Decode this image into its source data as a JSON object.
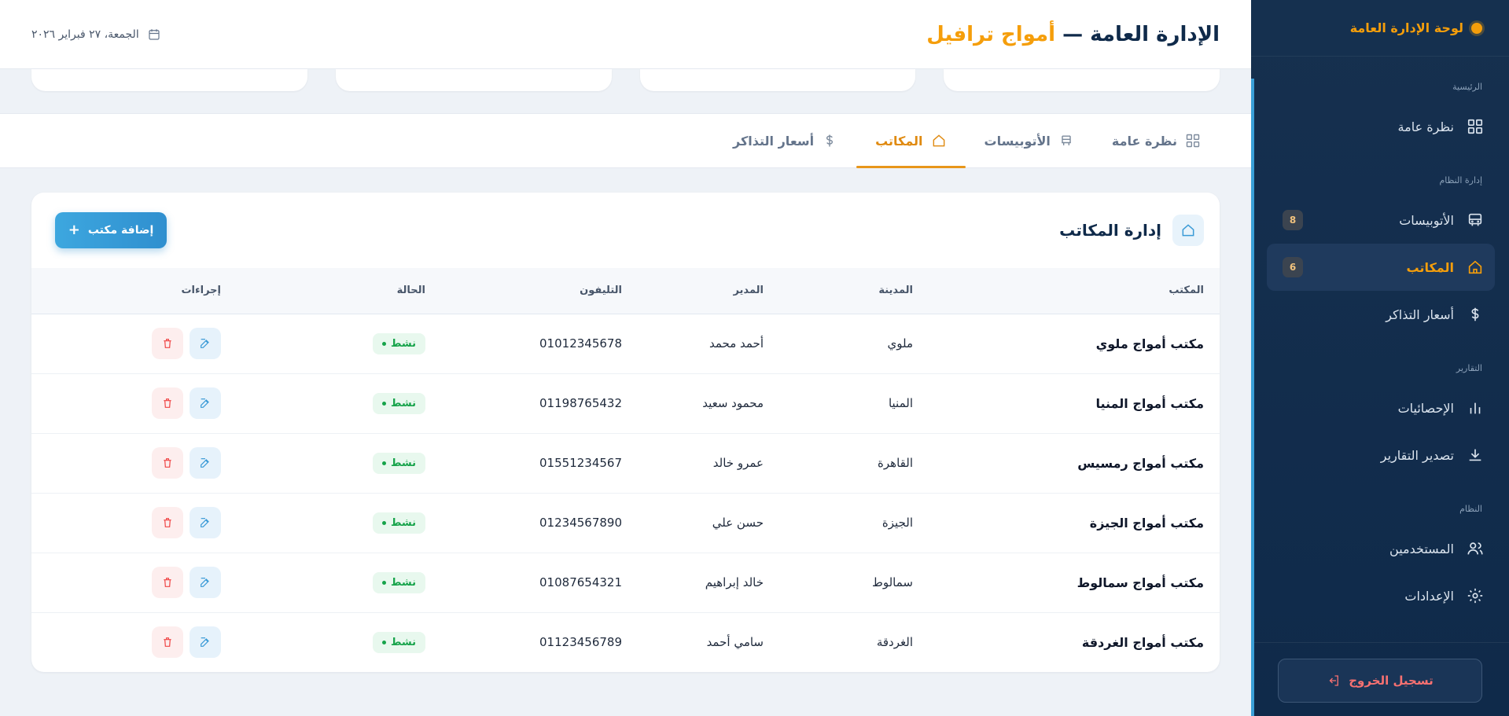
{
  "sidebar": {
    "brand": "لوحة الإدارة العامة",
    "sections": {
      "home": "الرئيسية",
      "system_mgmt": "إدارة النظام",
      "reports": "التقارير",
      "system": "النظام"
    },
    "items": {
      "overview": "نظرة عامة",
      "buses": "الأتوبيسات",
      "buses_count": "8",
      "offices": "المكاتب",
      "offices_count": "6",
      "ticket_prices": "أسعار التذاكر",
      "statistics": "الإحصائيات",
      "export_reports": "تصدير التقارير",
      "users": "المستخدمين",
      "settings": "الإعدادات"
    },
    "logout": "تسجيل الخروج"
  },
  "header": {
    "title_main": "الإدارة العامة —",
    "title_accent": "أمواج ترافيل",
    "date": "الجمعة، ٢٧ فبراير ٢٠٢٦"
  },
  "tabs": [
    {
      "label": "نظرة عامة",
      "icon": "grid-icon"
    },
    {
      "label": "الأتوبيسات",
      "icon": "bus-icon"
    },
    {
      "label": "المكاتب",
      "icon": "home-icon",
      "active": true
    },
    {
      "label": "أسعار التذاكر",
      "icon": "dollar-icon"
    }
  ],
  "panel": {
    "title": "إدارة المكاتب",
    "add_button": "إضافة مكتب"
  },
  "table": {
    "headers": {
      "office": "المكتب",
      "city": "المدينة",
      "manager": "المدير",
      "phone": "التليفون",
      "status": "الحالة",
      "actions": "إجراءات"
    },
    "rows": [
      {
        "office": "مكتب أمواج ملوي",
        "city": "ملوي",
        "manager": "أحمد محمد",
        "phone": "01012345678",
        "status": "نشط"
      },
      {
        "office": "مكتب أمواج المنيا",
        "city": "المنيا",
        "manager": "محمود سعيد",
        "phone": "01198765432",
        "status": "نشط"
      },
      {
        "office": "مكتب أمواج رمسيس",
        "city": "القاهرة",
        "manager": "عمرو خالد",
        "phone": "01551234567",
        "status": "نشط"
      },
      {
        "office": "مكتب أمواج الجيزة",
        "city": "الجيزة",
        "manager": "حسن علي",
        "phone": "01234567890",
        "status": "نشط"
      },
      {
        "office": "مكتب أمواج سمالوط",
        "city": "سمالوط",
        "manager": "خالد إبراهيم",
        "phone": "01087654321",
        "status": "نشط"
      },
      {
        "office": "مكتب أمواج الغردقة",
        "city": "الغردقة",
        "manager": "سامي أحمد",
        "phone": "01123456789",
        "status": "نشط"
      }
    ]
  },
  "colors": {
    "accent": "#f59e0b",
    "sidebar": "#0f2a4a",
    "primary": "#3a9ad6",
    "success": "#16a34a",
    "danger": "#ef4444"
  }
}
